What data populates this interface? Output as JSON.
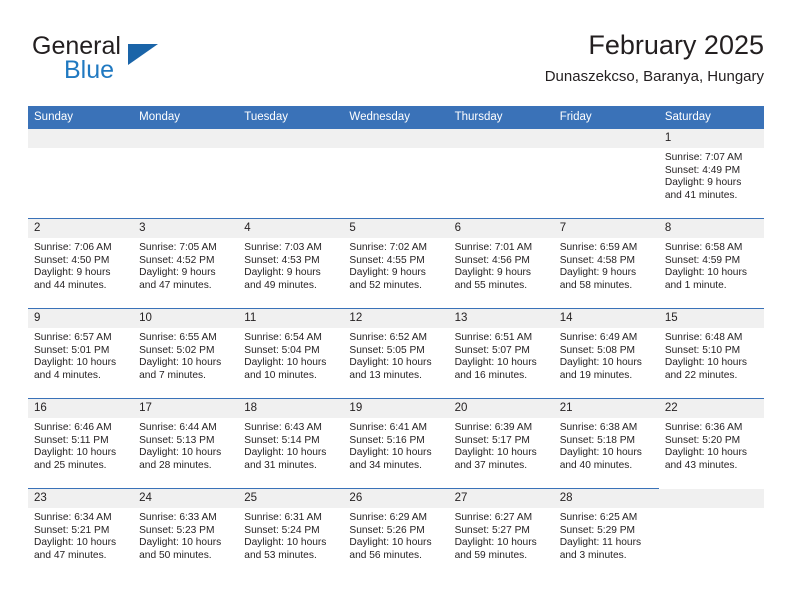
{
  "logo": {
    "word_top": "General",
    "word_bottom": "Blue",
    "accent_color": "#2079c1",
    "triangle_color": "#1a64a8"
  },
  "header": {
    "title": "February 2025",
    "subtitle": "Dunaszekcso, Baranya, Hungary"
  },
  "theme": {
    "header_blue": "#3a72b8",
    "daynum_band": "#f0f0f0",
    "text": "#231f20"
  },
  "calendar": {
    "weekday_headers": [
      "Sunday",
      "Monday",
      "Tuesday",
      "Wednesday",
      "Thursday",
      "Friday",
      "Saturday"
    ],
    "weeks": [
      [
        {
          "day": "",
          "blank": true
        },
        {
          "day": "",
          "blank": true
        },
        {
          "day": "",
          "blank": true
        },
        {
          "day": "",
          "blank": true
        },
        {
          "day": "",
          "blank": true
        },
        {
          "day": "",
          "blank": true
        },
        {
          "day": "1",
          "sunrise": "Sunrise: 7:07 AM",
          "sunset": "Sunset: 4:49 PM",
          "daylight": "Daylight: 9 hours and 41 minutes."
        }
      ],
      [
        {
          "day": "2",
          "sunrise": "Sunrise: 7:06 AM",
          "sunset": "Sunset: 4:50 PM",
          "daylight": "Daylight: 9 hours and 44 minutes."
        },
        {
          "day": "3",
          "sunrise": "Sunrise: 7:05 AM",
          "sunset": "Sunset: 4:52 PM",
          "daylight": "Daylight: 9 hours and 47 minutes."
        },
        {
          "day": "4",
          "sunrise": "Sunrise: 7:03 AM",
          "sunset": "Sunset: 4:53 PM",
          "daylight": "Daylight: 9 hours and 49 minutes."
        },
        {
          "day": "5",
          "sunrise": "Sunrise: 7:02 AM",
          "sunset": "Sunset: 4:55 PM",
          "daylight": "Daylight: 9 hours and 52 minutes."
        },
        {
          "day": "6",
          "sunrise": "Sunrise: 7:01 AM",
          "sunset": "Sunset: 4:56 PM",
          "daylight": "Daylight: 9 hours and 55 minutes."
        },
        {
          "day": "7",
          "sunrise": "Sunrise: 6:59 AM",
          "sunset": "Sunset: 4:58 PM",
          "daylight": "Daylight: 9 hours and 58 minutes."
        },
        {
          "day": "8",
          "sunrise": "Sunrise: 6:58 AM",
          "sunset": "Sunset: 4:59 PM",
          "daylight": "Daylight: 10 hours and 1 minute."
        }
      ],
      [
        {
          "day": "9",
          "sunrise": "Sunrise: 6:57 AM",
          "sunset": "Sunset: 5:01 PM",
          "daylight": "Daylight: 10 hours and 4 minutes."
        },
        {
          "day": "10",
          "sunrise": "Sunrise: 6:55 AM",
          "sunset": "Sunset: 5:02 PM",
          "daylight": "Daylight: 10 hours and 7 minutes."
        },
        {
          "day": "11",
          "sunrise": "Sunrise: 6:54 AM",
          "sunset": "Sunset: 5:04 PM",
          "daylight": "Daylight: 10 hours and 10 minutes."
        },
        {
          "day": "12",
          "sunrise": "Sunrise: 6:52 AM",
          "sunset": "Sunset: 5:05 PM",
          "daylight": "Daylight: 10 hours and 13 minutes."
        },
        {
          "day": "13",
          "sunrise": "Sunrise: 6:51 AM",
          "sunset": "Sunset: 5:07 PM",
          "daylight": "Daylight: 10 hours and 16 minutes."
        },
        {
          "day": "14",
          "sunrise": "Sunrise: 6:49 AM",
          "sunset": "Sunset: 5:08 PM",
          "daylight": "Daylight: 10 hours and 19 minutes."
        },
        {
          "day": "15",
          "sunrise": "Sunrise: 6:48 AM",
          "sunset": "Sunset: 5:10 PM",
          "daylight": "Daylight: 10 hours and 22 minutes."
        }
      ],
      [
        {
          "day": "16",
          "sunrise": "Sunrise: 6:46 AM",
          "sunset": "Sunset: 5:11 PM",
          "daylight": "Daylight: 10 hours and 25 minutes."
        },
        {
          "day": "17",
          "sunrise": "Sunrise: 6:44 AM",
          "sunset": "Sunset: 5:13 PM",
          "daylight": "Daylight: 10 hours and 28 minutes."
        },
        {
          "day": "18",
          "sunrise": "Sunrise: 6:43 AM",
          "sunset": "Sunset: 5:14 PM",
          "daylight": "Daylight: 10 hours and 31 minutes."
        },
        {
          "day": "19",
          "sunrise": "Sunrise: 6:41 AM",
          "sunset": "Sunset: 5:16 PM",
          "daylight": "Daylight: 10 hours and 34 minutes."
        },
        {
          "day": "20",
          "sunrise": "Sunrise: 6:39 AM",
          "sunset": "Sunset: 5:17 PM",
          "daylight": "Daylight: 10 hours and 37 minutes."
        },
        {
          "day": "21",
          "sunrise": "Sunrise: 6:38 AM",
          "sunset": "Sunset: 5:18 PM",
          "daylight": "Daylight: 10 hours and 40 minutes."
        },
        {
          "day": "22",
          "sunrise": "Sunrise: 6:36 AM",
          "sunset": "Sunset: 5:20 PM",
          "daylight": "Daylight: 10 hours and 43 minutes."
        }
      ],
      [
        {
          "day": "23",
          "sunrise": "Sunrise: 6:34 AM",
          "sunset": "Sunset: 5:21 PM",
          "daylight": "Daylight: 10 hours and 47 minutes."
        },
        {
          "day": "24",
          "sunrise": "Sunrise: 6:33 AM",
          "sunset": "Sunset: 5:23 PM",
          "daylight": "Daylight: 10 hours and 50 minutes."
        },
        {
          "day": "25",
          "sunrise": "Sunrise: 6:31 AM",
          "sunset": "Sunset: 5:24 PM",
          "daylight": "Daylight: 10 hours and 53 minutes."
        },
        {
          "day": "26",
          "sunrise": "Sunrise: 6:29 AM",
          "sunset": "Sunset: 5:26 PM",
          "daylight": "Daylight: 10 hours and 56 minutes."
        },
        {
          "day": "27",
          "sunrise": "Sunrise: 6:27 AM",
          "sunset": "Sunset: 5:27 PM",
          "daylight": "Daylight: 10 hours and 59 minutes."
        },
        {
          "day": "28",
          "sunrise": "Sunrise: 6:25 AM",
          "sunset": "Sunset: 5:29 PM",
          "daylight": "Daylight: 11 hours and 3 minutes."
        },
        {
          "day": "",
          "blank": true
        }
      ]
    ]
  }
}
